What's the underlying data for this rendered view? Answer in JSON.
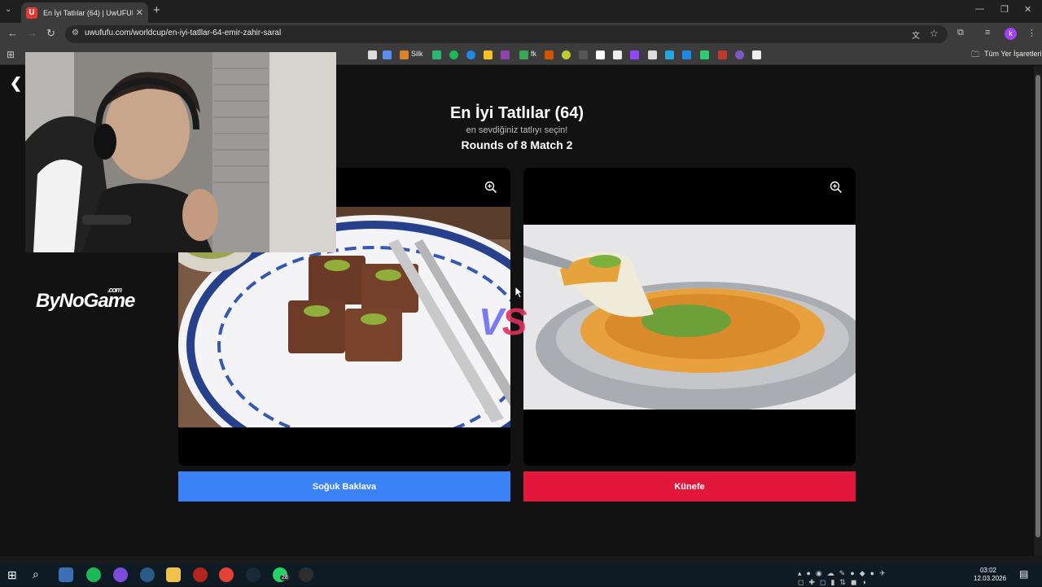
{
  "browser": {
    "tab": {
      "favicon_letter": "U",
      "title": "En İyi Tatlılar (64) | UwUFUFU"
    },
    "url": "uwufufu.com/worldcup/en-iyi-tatllar-64-emir-zahir-saral",
    "profile_letter": "k",
    "bookmarks": {
      "silk_label": "Silk",
      "fk_label": "fk",
      "all_bookmarks_label": "Tüm Yer İşaretleri"
    }
  },
  "page": {
    "title": "En İyi Tatlılar (64)",
    "subtitle": "en sevdiğiniz tatlıyı seçin!",
    "round": "Rounds of 8 Match 2",
    "vs_label": "VS",
    "sponsor": {
      "name": "ByNoGame",
      "suffix": ".com"
    }
  },
  "choices": [
    {
      "label": "Soğuk Baklava",
      "color": "#3b82f6"
    },
    {
      "label": "Künefe",
      "color": "#e2173b"
    }
  ],
  "taskbar": {
    "whatsapp_badge": "28",
    "time": "03:02",
    "date": "12.03.2026"
  }
}
